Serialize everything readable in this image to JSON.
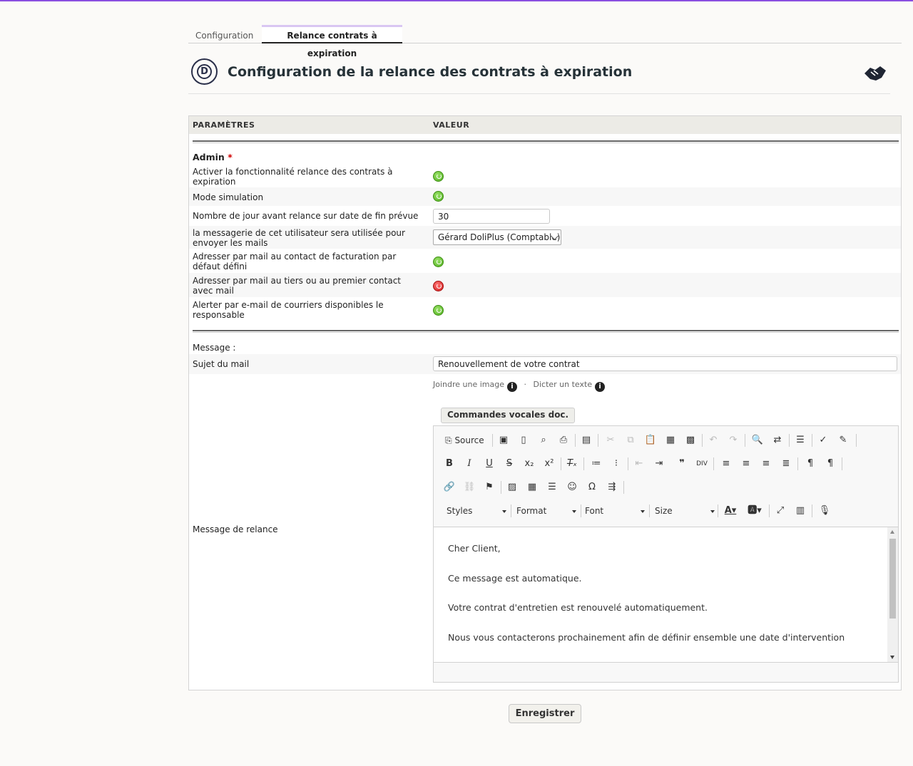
{
  "tabs": [
    {
      "label": "Configuration"
    },
    {
      "label": "Relance contrats à expiration"
    }
  ],
  "header": {
    "title": "Configuration de la relance des contrats à expiration",
    "logo_letter": "D"
  },
  "table": {
    "col_params": "PARAMÈTRES",
    "col_value": "VALEUR"
  },
  "admin": {
    "heading": "Admin",
    "required_mark": "*"
  },
  "settings": {
    "activate": {
      "label": "Activer la fonctionnalité relance des contrats à expiration",
      "state": "on"
    },
    "simulation": {
      "label": "Mode simulation",
      "state": "on"
    },
    "days_before": {
      "label": "Nombre de jour avant relance sur date de fin prévue",
      "value": "30"
    },
    "sender_user": {
      "label": "la messagerie de cet utilisateur sera utilisée pour envoyer les mails",
      "value": "Gérard DoliPlus (Comptable)"
    },
    "billing_contact": {
      "label": "Adresser par mail au contact de facturation par défaut défini",
      "state": "on"
    },
    "thirdparty_contact": {
      "label": "Adresser par mail au tiers ou au premier contact avec mail",
      "state": "off"
    },
    "alert_responsible": {
      "label": "Alerter par e-mail de courriers disponibles le responsable",
      "state": "on"
    }
  },
  "message": {
    "section_label": "Message :",
    "subject_label": "Sujet du mail",
    "subject_value": "Renouvellement de votre contrat",
    "attach_image": "Joindre une image",
    "dot": "·",
    "dictate": "Dicter un texte",
    "info_icon": "i",
    "voice_button": "Commandes vocales doc.",
    "body_label": "Message de relance",
    "body_lines": [
      "Cher Client,",
      "Ce message est automatique.",
      "Votre contrat d'entretien est renouvelé automatiquement.",
      "Nous vous contacterons prochainement afin de définir ensemble une date d'intervention"
    ]
  },
  "editor": {
    "source_label": "Source",
    "styles_label": "Styles",
    "format_label": "Format",
    "font_label": "Font",
    "size_label": "Size"
  },
  "save_button": "Enregistrer",
  "colors": {
    "accent": "#8a4fe0",
    "toggle_on": "#4fae1d",
    "toggle_off": "#d11a1a",
    "required": "#d00000"
  }
}
